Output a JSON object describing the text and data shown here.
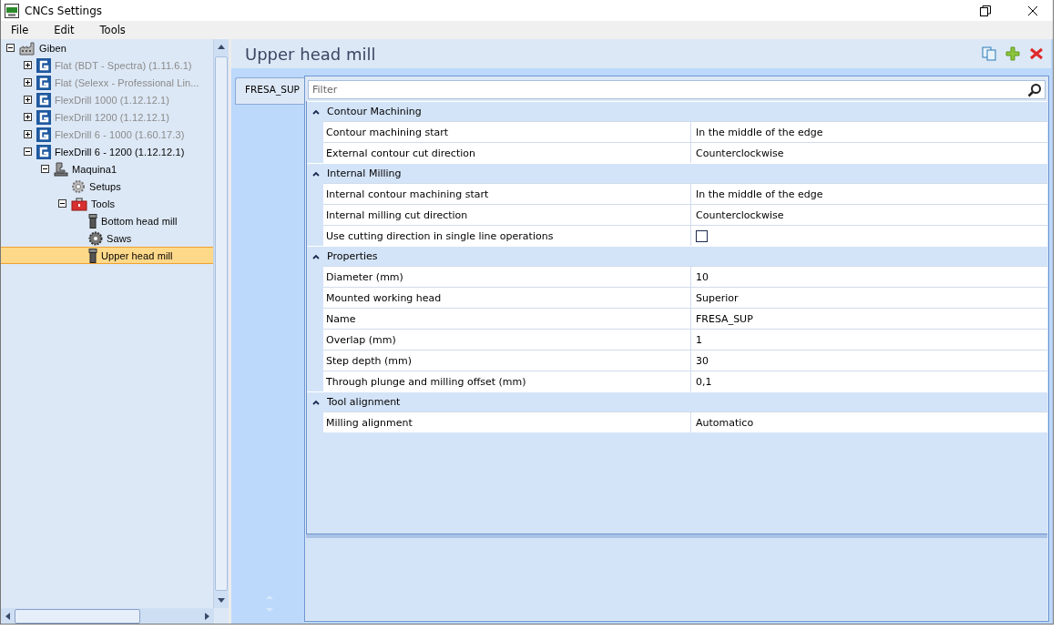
{
  "window": {
    "title": "CNCs Settings"
  },
  "menu": [
    {
      "label": "File"
    },
    {
      "label": "Edit"
    },
    {
      "label": "Tools"
    }
  ],
  "tree": [
    {
      "label": "Giben",
      "kind": "factory",
      "expanded": true,
      "disabled": false,
      "selected": false,
      "children": [
        {
          "label": "Flat (BDT - Spectra) (1.11.6.1)",
          "kind": "logo",
          "expanded": false,
          "disabled": true,
          "selected": false
        },
        {
          "label": "Flat (Selexx - Professional Lin...",
          "kind": "logo",
          "expanded": false,
          "disabled": true,
          "selected": false
        },
        {
          "label": "FlexDrill 1000 (1.12.12.1)",
          "kind": "logo",
          "expanded": false,
          "disabled": true,
          "selected": false
        },
        {
          "label": "FlexDrill 1200 (1.12.12.1)",
          "kind": "logo",
          "expanded": false,
          "disabled": true,
          "selected": false
        },
        {
          "label": "FlexDrill 6 - 1000 (1.60.17.3)",
          "kind": "logo",
          "expanded": false,
          "disabled": true,
          "selected": false
        },
        {
          "label": "FlexDrill 6 - 1200 (1.12.12.1)",
          "kind": "logo",
          "expanded": true,
          "disabled": false,
          "selected": false,
          "children": [
            {
              "label": "Maquina1",
              "kind": "machine",
              "expanded": true,
              "disabled": false,
              "selected": false,
              "children": [
                {
                  "label": "Setups",
                  "kind": "gear",
                  "disabled": false,
                  "selected": false
                },
                {
                  "label": "Tools",
                  "kind": "toolbox",
                  "expanded": true,
                  "disabled": false,
                  "selected": false,
                  "children": [
                    {
                      "label": "Bottom head mill",
                      "kind": "mill",
                      "disabled": false,
                      "selected": false
                    },
                    {
                      "label": "Saws",
                      "kind": "saw",
                      "disabled": false,
                      "selected": false
                    },
                    {
                      "label": "Upper head mill",
                      "kind": "mill",
                      "disabled": false,
                      "selected": true
                    }
                  ]
                }
              ]
            }
          ]
        }
      ]
    }
  ],
  "header": {
    "title": "Upper head mill"
  },
  "tabs": [
    {
      "label": "FRESA_SUP",
      "selected": true
    }
  ],
  "filter": {
    "placeholder": "Filter"
  },
  "categories": [
    {
      "name": "Contour Machining",
      "expanded": true,
      "rows": [
        {
          "name": "Contour machining start",
          "kind": "text",
          "value": "In the middle of the edge"
        },
        {
          "name": "External contour cut direction",
          "kind": "text",
          "value": "Counterclockwise"
        }
      ]
    },
    {
      "name": "Internal Milling",
      "expanded": true,
      "rows": [
        {
          "name": "Internal contour machining start",
          "kind": "text",
          "value": "In the middle of the edge"
        },
        {
          "name": "Internal milling cut direction",
          "kind": "text",
          "value": "Counterclockwise"
        },
        {
          "name": "Use cutting direction in single line operations",
          "kind": "checkbox",
          "checked": false
        }
      ]
    },
    {
      "name": "Properties",
      "expanded": true,
      "rows": [
        {
          "name": "Diameter (mm)",
          "kind": "text",
          "value": "10"
        },
        {
          "name": "Mounted working head",
          "kind": "text",
          "value": "Superior"
        },
        {
          "name": "Name",
          "kind": "text",
          "value": "FRESA_SUP"
        },
        {
          "name": "Overlap (mm)",
          "kind": "text",
          "value": "1"
        },
        {
          "name": "Step depth (mm)",
          "kind": "text",
          "value": "30"
        },
        {
          "name": "Through plunge and milling offset (mm)",
          "kind": "text",
          "value": "0,1"
        }
      ]
    },
    {
      "name": "Tool alignment",
      "expanded": true,
      "rows": [
        {
          "name": "Milling alignment",
          "kind": "text",
          "value": "Automatico"
        }
      ]
    }
  ]
}
